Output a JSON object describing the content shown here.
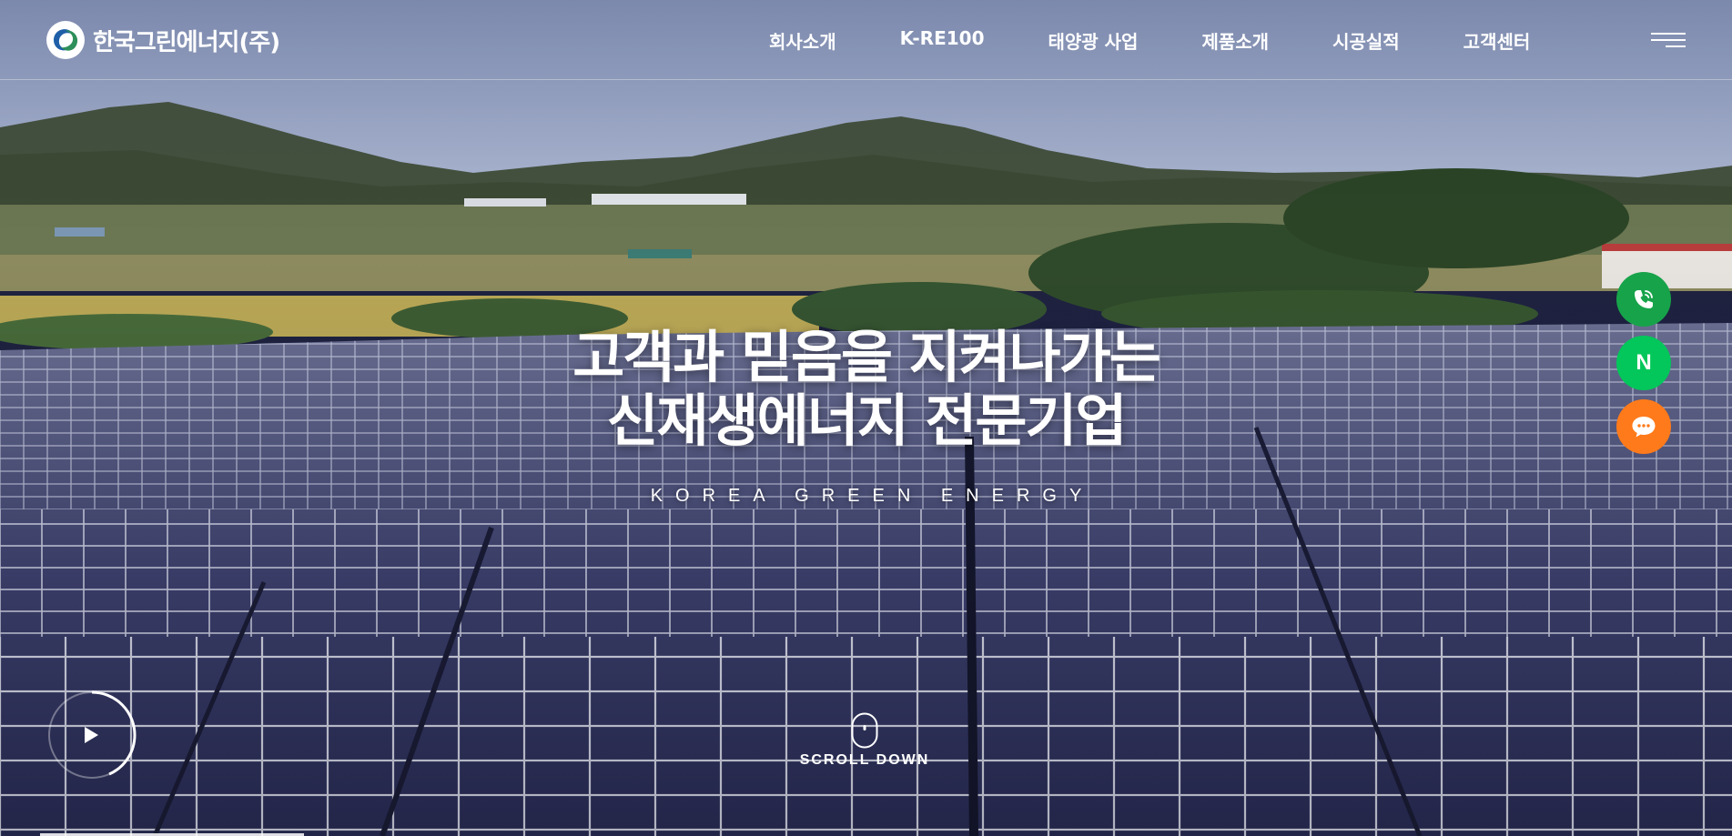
{
  "header": {
    "logo_text": "한국그린에너지(주)",
    "nav": [
      "회사소개",
      "K-RE100",
      "태양광 사업",
      "제품소개",
      "시공실적",
      "고객센터"
    ],
    "menu_icon": "hamburger-icon"
  },
  "hero": {
    "title_line1": "고객과 믿음을 지켜나가는",
    "title_line2": "신재생에너지 전문기업",
    "subtitle": "KOREA GREEN ENERGY"
  },
  "quick_buttons": [
    {
      "icon": "phone-icon",
      "color": "#17a34a"
    },
    {
      "label": "N",
      "icon": "naver-icon",
      "color": "#03c75a"
    },
    {
      "icon": "chat-icon",
      "color": "#ff7a1a"
    }
  ],
  "controls": {
    "play_icon": "play-icon",
    "scroll_label": "SCROLL DOWN"
  },
  "colors": {
    "accent_green": "#17a34a",
    "naver_green": "#03c75a",
    "chat_orange": "#ff7a1a"
  }
}
